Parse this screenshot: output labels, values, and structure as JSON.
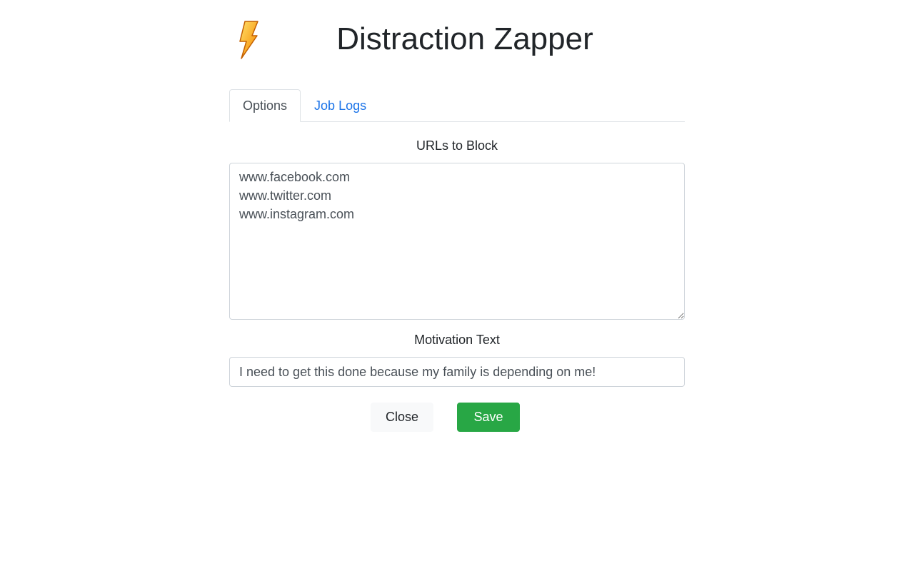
{
  "app": {
    "title": "Distraction Zapper",
    "logo_icon": "lightning-bolt-icon"
  },
  "tabs": [
    {
      "label": "Options",
      "active": true
    },
    {
      "label": "Job Logs",
      "active": false
    }
  ],
  "urls_section": {
    "label": "URLs to Block",
    "value": "www.facebook.com\nwww.twitter.com\nwww.instagram.com"
  },
  "motivation_section": {
    "label": "Motivation Text",
    "value": "I need to get this done because my family is depending on me!"
  },
  "buttons": {
    "close_label": "Close",
    "save_label": "Save"
  },
  "colors": {
    "accent_link": "#1a73e8",
    "save_green": "#28a745",
    "close_bg": "#f8f9fa"
  }
}
